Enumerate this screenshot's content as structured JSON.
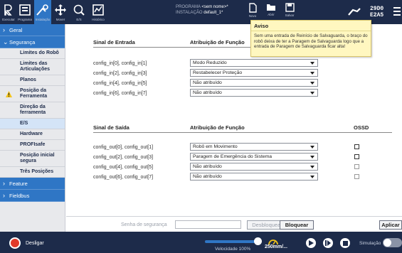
{
  "topbar": {
    "nav": [
      {
        "label": "Executar",
        "icon": "run-icon"
      },
      {
        "label": "Programa",
        "icon": "program-icon"
      },
      {
        "label": "Instalação",
        "icon": "installation-icon"
      },
      {
        "label": "Mover",
        "icon": "move-icon"
      },
      {
        "label": "E/S",
        "icon": "io-icon"
      },
      {
        "label": "Histórico",
        "icon": "log-icon"
      }
    ],
    "program_label": "PROGRAMA",
    "program_value": "<sem nome>*",
    "installation_label": "INSTALAÇÃO",
    "installation_value": "default_1*",
    "file_buttons": [
      {
        "label": "Novo"
      },
      {
        "label": "Abrir"
      },
      {
        "label": "Salvar"
      }
    ],
    "safety_checksum_line1": "29D0",
    "safety_checksum_line2": "E2A5"
  },
  "sidebar": {
    "geral": "Geral",
    "seguranca": "Segurança",
    "items": [
      {
        "label": "Limites do Robô"
      },
      {
        "label": "Limites das Articulações"
      },
      {
        "label": "Planos"
      },
      {
        "label": "Posição da Ferramenta"
      },
      {
        "label": "Direção da ferramenta"
      },
      {
        "label": "E/S"
      },
      {
        "label": "Hardware"
      },
      {
        "label": "PROFIsafe"
      },
      {
        "label": "Posição inicial segura"
      },
      {
        "label": "Três Posições"
      }
    ],
    "feature": "Feature",
    "fieldbus": "Fieldbus"
  },
  "inputs": {
    "header_signal": "Sinal de Entrada",
    "header_function": "Atribuição de Função",
    "rows": [
      {
        "signal": "config_in[0], config_in[1]",
        "function": "Modo Reduzido"
      },
      {
        "signal": "config_in[2], config_in[3]",
        "function": "Restabelecer Proteção"
      },
      {
        "signal": "config_in[4], config_in[5]",
        "function": "Não atribuído"
      },
      {
        "signal": "config_in[6], config_in[7]",
        "function": "Não atribuído"
      }
    ]
  },
  "outputs": {
    "header_signal": "Sinal de Saída",
    "header_function": "Atribuição de Função",
    "header_ossd": "OSSD",
    "rows": [
      {
        "signal": "config_out[0], config_out[1]",
        "function": "Robô em Movimento"
      },
      {
        "signal": "config_out[2], config_out[3]",
        "function": "Paragem de Emergência do Sistema"
      },
      {
        "signal": "config_out[4], config_out[5]",
        "function": "Não atribuído"
      },
      {
        "signal": "config_out[6], config_out[7]",
        "function": "Não atribuído"
      }
    ]
  },
  "tooltip": {
    "title": "Aviso",
    "body": "Sem uma entrada de Reinício de Salvaguarda, o braço do robô deixa de ter a Paragem de Salvaguarda logo que a entrada de Paragem de Salvaguarda ficar alta!"
  },
  "safety_bar": {
    "password_placeholder": "Senha de segurança",
    "password_value": "",
    "unlock_label": "Desbloquear",
    "lock_label": "Bloquear",
    "apply_label": "Aplicar"
  },
  "footer": {
    "power_label": "Desligar",
    "speed_label": "Velocidade 100%",
    "speed_fraction": 1.0,
    "tcp_speed": "250mm/...",
    "simulation_label": "Simulação"
  },
  "colors": {
    "navy": "#1d2b4a",
    "accent": "#2f76c5",
    "power": "#e03a2a",
    "tooltip_bg": "#fff7c0"
  }
}
